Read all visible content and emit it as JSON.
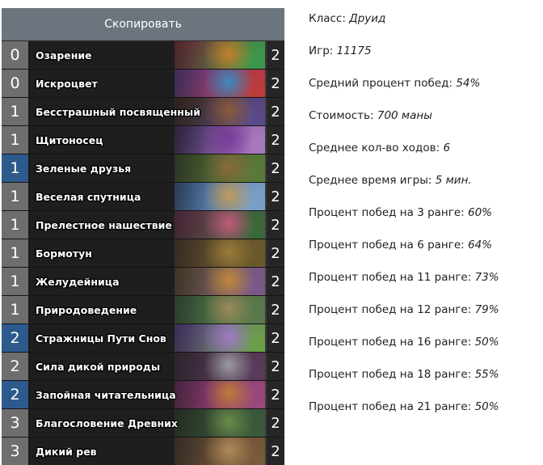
{
  "copy_button": "Скопировать",
  "cards": [
    {
      "cost": "0",
      "name": "Озарение",
      "count": "2",
      "rarity": "common",
      "art": [
        "#7a2a3a",
        "#c0802a",
        "#3a9a4a"
      ]
    },
    {
      "cost": "0",
      "name": "Искроцвет",
      "count": "2",
      "rarity": "common",
      "art": [
        "#5a3a8a",
        "#3a8ac0",
        "#c03a3a"
      ]
    },
    {
      "cost": "1",
      "name": "Бесстрашный посвященный",
      "count": "2",
      "rarity": "common",
      "art": [
        "#3a2a1a",
        "#8a5a3a",
        "#5a4a8a"
      ]
    },
    {
      "cost": "1",
      "name": "Щитоносец",
      "count": "2",
      "rarity": "common",
      "art": [
        "#3a2a5a",
        "#7a3a9a",
        "#aa7ac0"
      ]
    },
    {
      "cost": "1",
      "name": "Зеленые друзья",
      "count": "2",
      "rarity": "rare",
      "art": [
        "#3a4a2a",
        "#8a6a3a",
        "#5a7a3a"
      ]
    },
    {
      "cost": "1",
      "name": "Веселая спутница",
      "count": "2",
      "rarity": "common",
      "art": [
        "#3a5a8a",
        "#c09a5a",
        "#7aa0c8"
      ]
    },
    {
      "cost": "1",
      "name": "Прелестное нашествие",
      "count": "2",
      "rarity": "common",
      "art": [
        "#6a2a4a",
        "#c05a7a",
        "#3a6a3a"
      ]
    },
    {
      "cost": "1",
      "name": "Бормотун",
      "count": "2",
      "rarity": "common",
      "art": [
        "#4a3a2a",
        "#9a7a3a",
        "#6a5a2a"
      ]
    },
    {
      "cost": "1",
      "name": "Желудейница",
      "count": "2",
      "rarity": "common",
      "art": [
        "#5a4a2a",
        "#c08a3a",
        "#7a5a8a"
      ]
    },
    {
      "cost": "1",
      "name": "Природоведение",
      "count": "2",
      "rarity": "common",
      "art": [
        "#3a5a3a",
        "#9a8a5a",
        "#5a7a4a"
      ]
    },
    {
      "cost": "2",
      "name": "Стражницы Пути Снов",
      "count": "2",
      "rarity": "rare",
      "art": [
        "#5a3a8a",
        "#a07ac8",
        "#6aa04a"
      ]
    },
    {
      "cost": "2",
      "name": "Сила дикой природы",
      "count": "2",
      "rarity": "common",
      "art": [
        "#3a2a3a",
        "#9a9aa0",
        "#5a3a5a"
      ]
    },
    {
      "cost": "2",
      "name": "Запойная читательница",
      "count": "2",
      "rarity": "rare",
      "art": [
        "#6a2a5a",
        "#c07a3a",
        "#9a4a7a"
      ]
    },
    {
      "cost": "3",
      "name": "Благословение Древних",
      "count": "2",
      "rarity": "common",
      "art": [
        "#2a3a2a",
        "#6a8a4a",
        "#3a5a3a"
      ]
    },
    {
      "cost": "3",
      "name": "Дикий рев",
      "count": "2",
      "rarity": "common",
      "art": [
        "#4a3a2a",
        "#b08a5a",
        "#7a5a3a"
      ]
    }
  ],
  "stats": [
    {
      "label": "Класс: ",
      "value": "Друид"
    },
    {
      "label": "Игр: ",
      "value": "11175"
    },
    {
      "label": "Средний процент побед: ",
      "value": "54%"
    },
    {
      "label": "Стоимость: ",
      "value": "700 маны"
    },
    {
      "label": "Среднее кол-во ходов: ",
      "value": "6"
    },
    {
      "label": "Среднее время игры: ",
      "value": "5 мин."
    },
    {
      "label": "Процент побед на 3 ранге: ",
      "value": "60%"
    },
    {
      "label": "Процент побед на 6 ранге: ",
      "value": "64%"
    },
    {
      "label": "Процент побед на 11 ранге: ",
      "value": "73%"
    },
    {
      "label": "Процент побед на 12 ранге: ",
      "value": "79%"
    },
    {
      "label": "Процент побед на 16 ранге: ",
      "value": "50%"
    },
    {
      "label": "Процент побед на 18 ранге: ",
      "value": "55%"
    },
    {
      "label": "Процент побед на 21 ранге: ",
      "value": "50%"
    }
  ]
}
